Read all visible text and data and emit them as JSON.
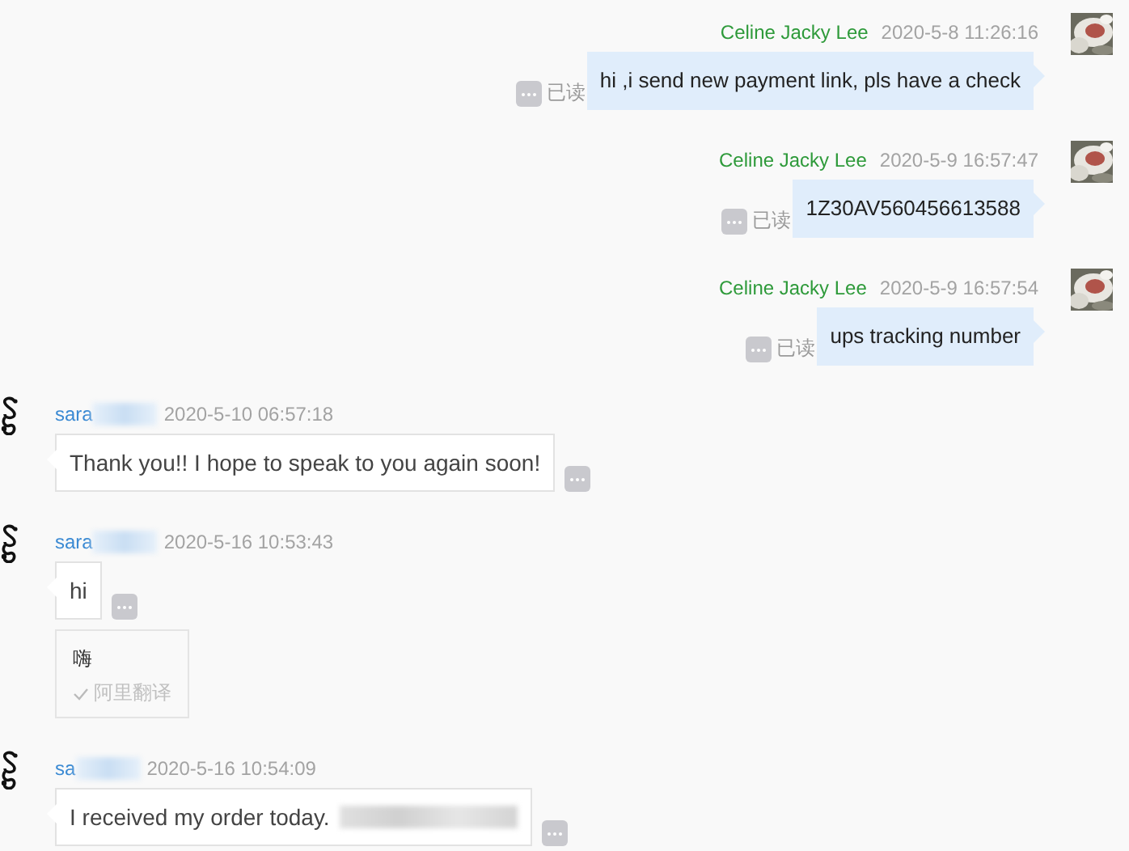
{
  "messages": [
    {
      "kind": "outgoing",
      "sender": "Celine Jacky Lee",
      "time": "2020-5-8 11:26:16",
      "text": "hi ,i send new payment link, pls have a check",
      "status": "已读"
    },
    {
      "kind": "outgoing",
      "sender": "Celine Jacky Lee",
      "time": "2020-5-9 16:57:47",
      "text": "1Z30AV560456613588",
      "status": "已读"
    },
    {
      "kind": "outgoing",
      "sender": "Celine Jacky Lee",
      "time": "2020-5-9 16:57:54",
      "text": "ups tracking number",
      "status": "已读"
    },
    {
      "kind": "incoming",
      "sender": "sara",
      "sender_redacted": true,
      "time": "2020-5-10 06:57:18",
      "text": "Thank you!! I hope to speak to you again soon!"
    },
    {
      "kind": "incoming",
      "sender": "sara",
      "sender_redacted": true,
      "time": "2020-5-16 10:53:43",
      "text": "hi",
      "translation": {
        "text": "嗨",
        "source": "阿里翻译"
      }
    },
    {
      "kind": "incoming",
      "sender": "sa",
      "sender_redacted": true,
      "time": "2020-5-16 10:54:09",
      "text": "I received my order today.",
      "text_redacted": true
    }
  ]
}
